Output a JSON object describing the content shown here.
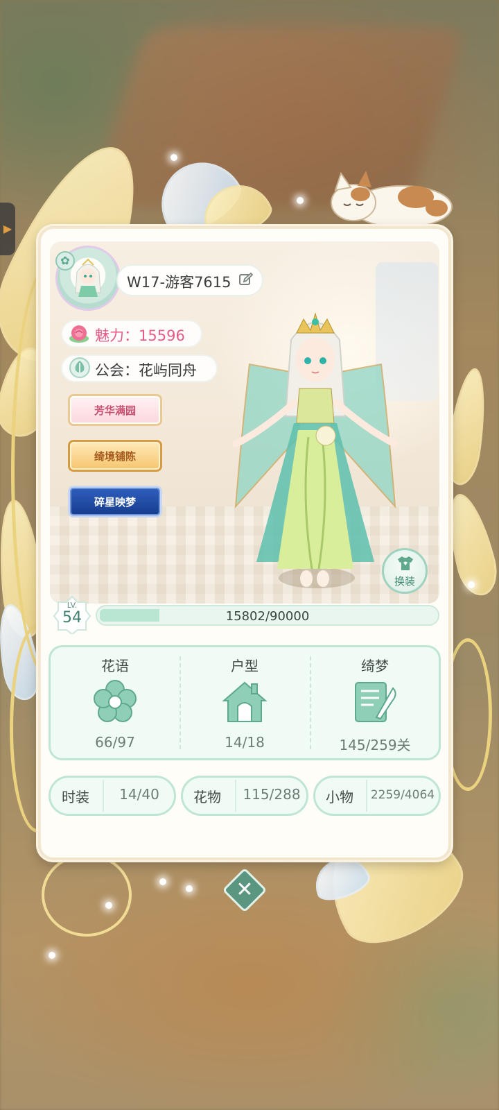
{
  "player": {
    "name": "W17-游客7615",
    "charm_label": "魅力：15596",
    "guild_label": "公会：花屿同舟"
  },
  "titles": [
    {
      "label": "芳华满园"
    },
    {
      "label": "绮境铺陈"
    },
    {
      "label": "碎星映梦"
    }
  ],
  "change_outfit": {
    "label": "换装"
  },
  "level": {
    "lv_label": "LV.",
    "value": "54",
    "xp_text": "15802/90000",
    "xp_fraction": 0.1756
  },
  "collection": [
    {
      "title": "花语",
      "icon": "flower-icon",
      "value": "66/97"
    },
    {
      "title": "户型",
      "icon": "house-icon",
      "value": "14/18"
    },
    {
      "title": "绮梦",
      "icon": "dream-scroll-icon",
      "value": "145/259关"
    }
  ],
  "mini_stats": [
    {
      "label": "时装",
      "value": "14/40"
    },
    {
      "label": "花物",
      "value": "115/288"
    },
    {
      "label": "小物",
      "value": "2259/4064"
    }
  ],
  "colors": {
    "accent_green": "#5b9680",
    "charm_pink": "#e55b86",
    "panel": "#fffdf8"
  }
}
